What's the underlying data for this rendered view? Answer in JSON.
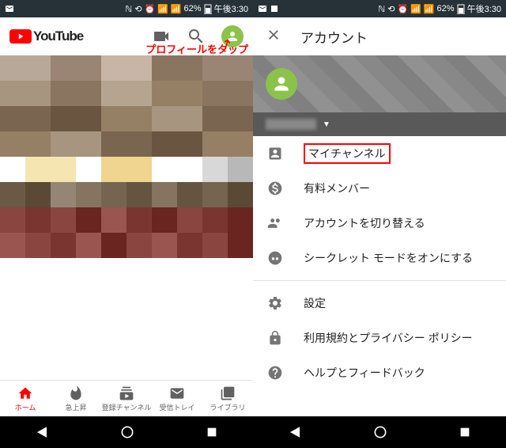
{
  "status": {
    "battery": "62%",
    "time": "午後3:30"
  },
  "youtube": {
    "brand": "YouTube"
  },
  "annotation": "プロフィールをタップ",
  "nav": {
    "home": "ホーム",
    "trending": "急上昇",
    "subs": "登録チャンネル",
    "inbox": "受信トレイ",
    "library": "ライブラリ"
  },
  "account": {
    "title": "アカウント",
    "items": {
      "channel": "マイチャンネル",
      "paid": "有料メンバー",
      "switch": "アカウントを切り替える",
      "incognito": "シークレット モードをオンにする",
      "settings": "設定",
      "terms": "利用規約とプライバシー ポリシー",
      "help": "ヘルプとフィードバック"
    }
  }
}
